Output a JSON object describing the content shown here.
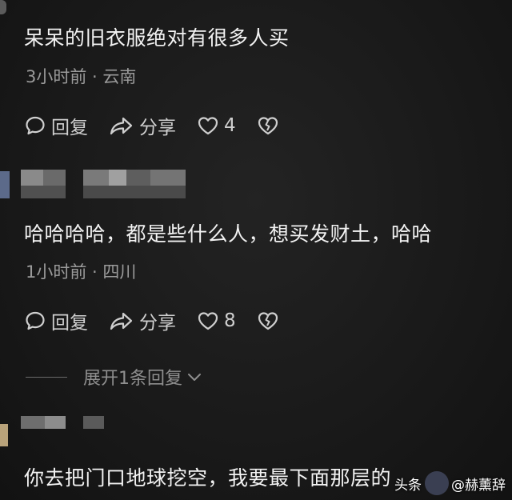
{
  "comments": [
    {
      "text": "呆呆的旧衣服绝对有很多人买",
      "meta": "3小时前 · 云南",
      "reply_label": "回复",
      "share_label": "分享",
      "likes": "4"
    },
    {
      "text": "哈哈哈哈，都是些什么人，想买发财土，哈哈",
      "meta": "1小时前 · 四川",
      "reply_label": "回复",
      "share_label": "分享",
      "likes": "8"
    },
    {
      "text": "你去把门口地球挖空，我要最下面那层的"
    }
  ],
  "expand_replies": "展开1条回复",
  "watermark": {
    "left_text": "头条",
    "handle": "@赫薰辞"
  },
  "icons": {
    "reply": "chat-bubble-icon",
    "share": "share-arrow-icon",
    "like": "heart-icon",
    "dislike": "broken-heart-icon",
    "expand": "chevron-down-icon"
  },
  "colors": {
    "background": "#181818",
    "text": "#f2f2f2",
    "meta": "#9a9a9a"
  }
}
